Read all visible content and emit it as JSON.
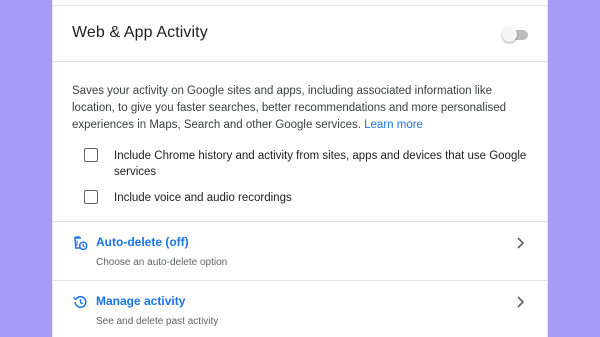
{
  "card": {
    "title": "Web & App Activity",
    "toggle_on": false,
    "description": "Saves your activity on Google sites and apps, including associated information like location, to give you faster searches, better recommendations and more personalised experiences in Maps, Search and other Google services.",
    "learn_more": "Learn more"
  },
  "options": [
    {
      "label": "Include Chrome history and activity from sites, apps and devices that use Google services",
      "checked": false
    },
    {
      "label": "Include voice and audio recordings",
      "checked": false
    }
  ],
  "sections": [
    {
      "title": "Auto-delete (off)",
      "subtitle": "Choose an auto-delete option",
      "icon": "auto-delete-icon"
    },
    {
      "title": "Manage activity",
      "subtitle": "See and delete past activity",
      "icon": "history-icon"
    }
  ],
  "colors": {
    "accent": "#1a73e8",
    "background": "#a49cf5",
    "toggle_track": "#bdbdbd"
  }
}
